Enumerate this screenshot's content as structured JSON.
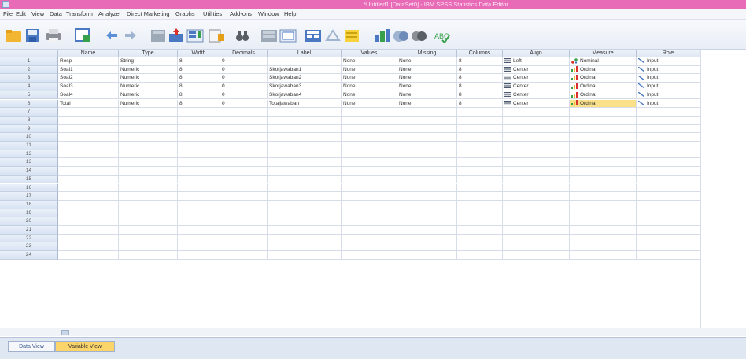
{
  "window": {
    "title": "*Untitled1 [DataSet0] - IBM SPSS Statistics Data Editor"
  },
  "menu": [
    "File",
    "Edit",
    "View",
    "Data",
    "Transform",
    "Analyze",
    "Direct Marketing",
    "Graphs",
    "Utilities",
    "Add-ons",
    "Window",
    "Help"
  ],
  "columns": [
    "Name",
    "Type",
    "Width",
    "Decimals",
    "Label",
    "Values",
    "Missing",
    "Columns",
    "Align",
    "Measure",
    "Role"
  ],
  "rows": [
    {
      "num": "1",
      "name": "Resp",
      "type": "String",
      "width": "8",
      "decimals": "0",
      "label": "",
      "values": "None",
      "missing": "None",
      "columns": "8",
      "align": "Left",
      "measure": "Nominal",
      "role": "Input"
    },
    {
      "num": "2",
      "name": "Soal1",
      "type": "Numeric",
      "width": "8",
      "decimals": "0",
      "label": "Skorjawaban1",
      "values": "None",
      "missing": "None",
      "columns": "8",
      "align": "Center",
      "measure": "Ordinal",
      "role": "Input"
    },
    {
      "num": "3",
      "name": "Soal2",
      "type": "Numeric",
      "width": "8",
      "decimals": "0",
      "label": "Skorjawaban2",
      "values": "None",
      "missing": "None",
      "columns": "8",
      "align": "Center",
      "measure": "Ordinal",
      "role": "Input"
    },
    {
      "num": "4",
      "name": "Soal3",
      "type": "Numeric",
      "width": "8",
      "decimals": "0",
      "label": "Skorjawaban3",
      "values": "None",
      "missing": "None",
      "columns": "8",
      "align": "Center",
      "measure": "Ordinal",
      "role": "Input"
    },
    {
      "num": "5",
      "name": "Soal4",
      "type": "Numeric",
      "width": "8",
      "decimals": "0",
      "label": "Skorjawaban4",
      "values": "None",
      "missing": "None",
      "columns": "8",
      "align": "Center",
      "measure": "Ordinal",
      "role": "Input"
    },
    {
      "num": "6",
      "name": "Total",
      "type": "Numeric",
      "width": "8",
      "decimals": "0",
      "label": "Totaljawaban",
      "values": "None",
      "missing": "None",
      "columns": "8",
      "align": "Center",
      "measure": "Ordinal",
      "role": "Input"
    }
  ],
  "empty_rows": [
    "7",
    "8",
    "9",
    "10",
    "11",
    "12",
    "13",
    "14",
    "15",
    "16",
    "17",
    "18",
    "19",
    "20",
    "21",
    "22",
    "23",
    "24"
  ],
  "selected_cell": {
    "row": "6",
    "column": "Measure"
  },
  "tabs": {
    "data_view": "Data View",
    "variable_view": "Variable View",
    "active": "Variable View"
  },
  "colors": {
    "titlebar": "#e86bb7",
    "selected": "#fbe08a",
    "active_tab": "#fbd46a"
  },
  "toolbar_icons": [
    "open-folder-icon",
    "save-icon",
    "print-icon",
    "dialog-recall-icon",
    "undo-icon",
    "redo-icon",
    "goto-case-icon",
    "goto-variable-icon",
    "variables-icon",
    "find-icon",
    "insert-cases-icon",
    "insert-variable-icon",
    "split-file-icon",
    "weight-cases-icon",
    "select-cases-icon",
    "value-labels-icon",
    "use-sets-icon",
    "show-all-variables-icon",
    "spell-check-icon"
  ]
}
